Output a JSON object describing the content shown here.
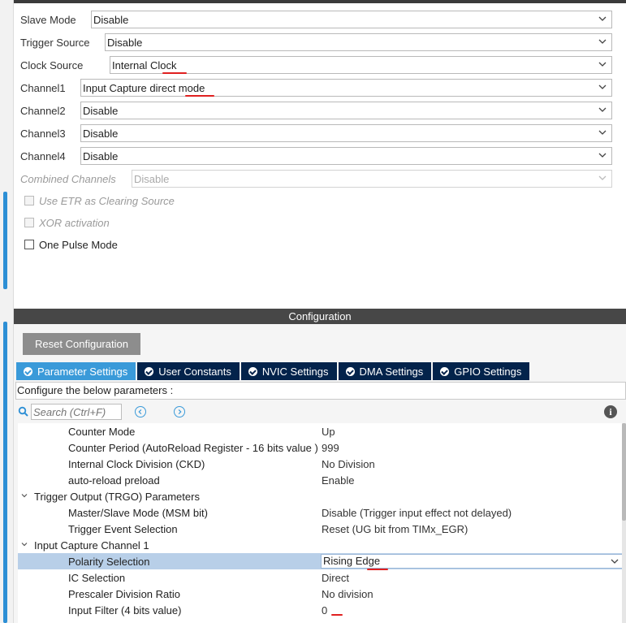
{
  "mode": {
    "slave_mode": {
      "label": "Slave Mode",
      "value": "Disable"
    },
    "trigger_source": {
      "label": "Trigger Source",
      "value": "Disable"
    },
    "clock_source": {
      "label": "Clock Source",
      "value": "Internal Clock"
    },
    "channel1": {
      "label": "Channel1",
      "value": "Input Capture direct mode"
    },
    "channel2": {
      "label": "Channel2",
      "value": "Disable"
    },
    "channel3": {
      "label": "Channel3",
      "value": "Disable"
    },
    "channel4": {
      "label": "Channel4",
      "value": "Disable"
    },
    "combined_channels": {
      "label": "Combined Channels",
      "value": "Disable"
    },
    "checkboxes": {
      "etr": "Use ETR as Clearing Source",
      "xor": "XOR activation",
      "one_pulse": "One Pulse Mode"
    }
  },
  "configuration": {
    "title": "Configuration",
    "reset_button": "Reset Configuration",
    "tabs": [
      {
        "label": "Parameter Settings"
      },
      {
        "label": "User Constants"
      },
      {
        "label": "NVIC Settings"
      },
      {
        "label": "DMA Settings"
      },
      {
        "label": "GPIO Settings"
      }
    ],
    "configure_text": "Configure the below parameters :",
    "search_placeholder": "Search (Ctrl+F)",
    "info_glyph": "i"
  },
  "params": {
    "counter_mode": {
      "name": "Counter Mode",
      "value": "Up"
    },
    "counter_period": {
      "name": "Counter Period (AutoReload Register - 16 bits value )",
      "value": "999"
    },
    "ckd": {
      "name": "Internal Clock Division (CKD)",
      "value": "No Division"
    },
    "auto_reload": {
      "name": "auto-reload preload",
      "value": "Enable"
    },
    "trgo_group": "Trigger Output (TRGO) Parameters",
    "msm": {
      "name": "Master/Slave Mode (MSM bit)",
      "value": "Disable (Trigger input effect not delayed)"
    },
    "trigger_event": {
      "name": "Trigger Event Selection",
      "value": "Reset (UG bit from TIMx_EGR)"
    },
    "ic1_group": "Input Capture Channel 1",
    "polarity": {
      "name": "Polarity Selection",
      "value": "Rising Edge"
    },
    "ic_selection": {
      "name": "IC Selection",
      "value": "Direct"
    },
    "prescaler": {
      "name": "Prescaler Division Ratio",
      "value": "No division"
    },
    "input_filter": {
      "name": "Input Filter (4 bits value)",
      "value": "0"
    }
  },
  "colors": {
    "accent": "#3a9ad9",
    "tab_dark": "#03234b",
    "annotation_red": "#e02020",
    "selected_row": "#b8cfe8"
  }
}
